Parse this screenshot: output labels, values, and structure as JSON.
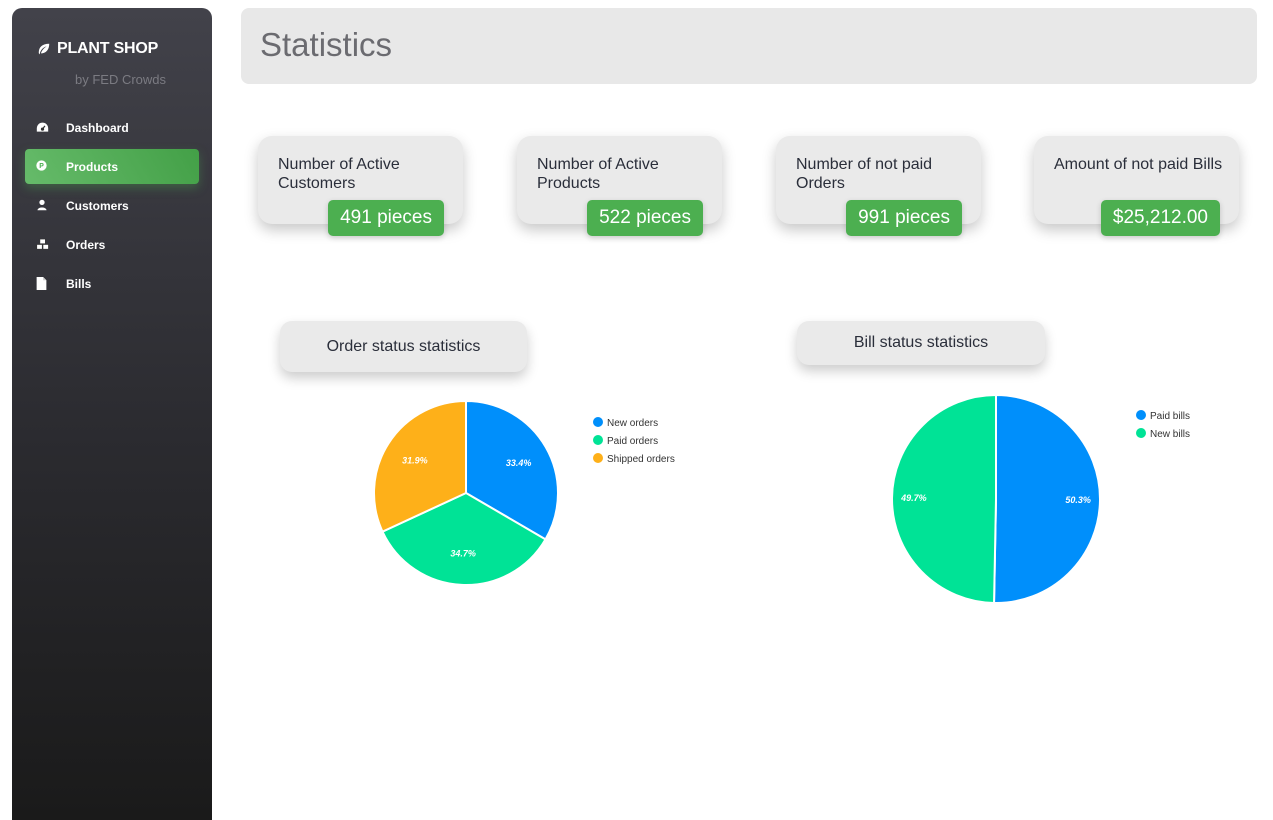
{
  "sidebar": {
    "brand": "PLANT SHOP",
    "brand_sub": "by FED Crowds",
    "items": [
      {
        "label": "Dashboard",
        "icon": "dashboard-icon"
      },
      {
        "label": "Products",
        "icon": "products-icon",
        "active": true
      },
      {
        "label": "Customers",
        "icon": "user-icon"
      },
      {
        "label": "Orders",
        "icon": "orders-icon"
      },
      {
        "label": "Bills",
        "icon": "file-icon"
      }
    ]
  },
  "header": {
    "title": "Statistics"
  },
  "stats": [
    {
      "title": "Number of Active Customers",
      "value": "491 pieces"
    },
    {
      "title": "Number of Active Products",
      "value": "522 pieces"
    },
    {
      "title": "Number of not paid Orders",
      "value": "991 pieces"
    },
    {
      "title": "Amount of not paid Bills",
      "value": "$25,212.00"
    }
  ],
  "colors": {
    "accent": "#4caf50",
    "blue": "#008ffb",
    "green": "#00e396",
    "orange": "#feb019"
  },
  "chart_data": [
    {
      "type": "pie",
      "title": "Order status statistics",
      "categories": [
        "New orders",
        "Paid orders",
        "Shipped orders"
      ],
      "values": [
        33.4,
        34.7,
        31.9
      ],
      "labels": [
        "33.4%",
        "34.7%",
        "31.9%"
      ],
      "colors": [
        "#008ffb",
        "#00e396",
        "#feb019"
      ],
      "legend": "right"
    },
    {
      "type": "pie",
      "title": "Bill status statistics",
      "categories": [
        "Paid bills",
        "New bills"
      ],
      "values": [
        50.3,
        49.7
      ],
      "labels": [
        "50.3%",
        "49.7%"
      ],
      "colors": [
        "#008ffb",
        "#00e396"
      ],
      "legend": "right"
    }
  ]
}
